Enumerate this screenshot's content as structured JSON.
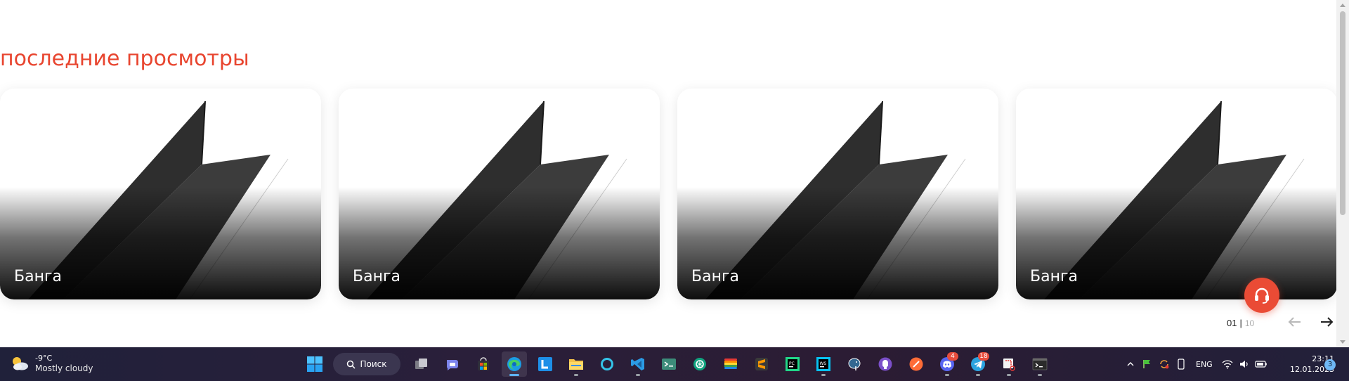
{
  "section": {
    "title": "последние просмотры"
  },
  "cards": [
    {
      "title": "Банга"
    },
    {
      "title": "Банга"
    },
    {
      "title": "Банга"
    },
    {
      "title": "Банга"
    }
  ],
  "pager": {
    "current": "01",
    "separator": "|",
    "total": "10"
  },
  "colors": {
    "accent": "#e8452f",
    "support_button": "#ea4b35"
  },
  "taskbar": {
    "weather": {
      "temp": "-9°C",
      "desc": "Mostly cloudy",
      "icon": "partly-cloudy-icon"
    },
    "search_label": "Поиск",
    "apps": [
      {
        "name": "task-view",
        "icon": "task-view-icon"
      },
      {
        "name": "teams-chat",
        "icon": "chat-icon"
      },
      {
        "name": "microsoft-store",
        "icon": "store-icon"
      },
      {
        "name": "edge",
        "icon": "edge-icon",
        "active": true
      },
      {
        "name": "launcher-l",
        "icon": "l-app-icon"
      },
      {
        "name": "file-explorer",
        "icon": "folder-icon"
      },
      {
        "name": "cortana",
        "icon": "ring-icon"
      },
      {
        "name": "vscode",
        "icon": "vscode-icon"
      },
      {
        "name": "terminal-app",
        "icon": "terminal-icon"
      },
      {
        "name": "chatgpt",
        "icon": "openai-icon"
      },
      {
        "name": "colorful-app",
        "icon": "rainbow-icon"
      },
      {
        "name": "sublime-text",
        "icon": "sublime-icon"
      },
      {
        "name": "pycharm",
        "icon": "pycharm-icon"
      },
      {
        "name": "webstorm",
        "icon": "webstorm-icon"
      },
      {
        "name": "postgresql",
        "icon": "elephant-icon"
      },
      {
        "name": "github-desktop",
        "icon": "github-icon"
      },
      {
        "name": "postman",
        "icon": "postman-icon"
      },
      {
        "name": "discord",
        "icon": "discord-icon",
        "badge": "4"
      },
      {
        "name": "telegram",
        "icon": "telegram-icon",
        "badge": "18"
      },
      {
        "name": "snipping-tool",
        "icon": "snip-icon"
      },
      {
        "name": "command-prompt",
        "icon": "cmd-icon"
      }
    ],
    "tray": {
      "language": "ENG"
    },
    "clock": {
      "time": "23:11",
      "date": "12.01.2023"
    },
    "notifications": "3"
  }
}
